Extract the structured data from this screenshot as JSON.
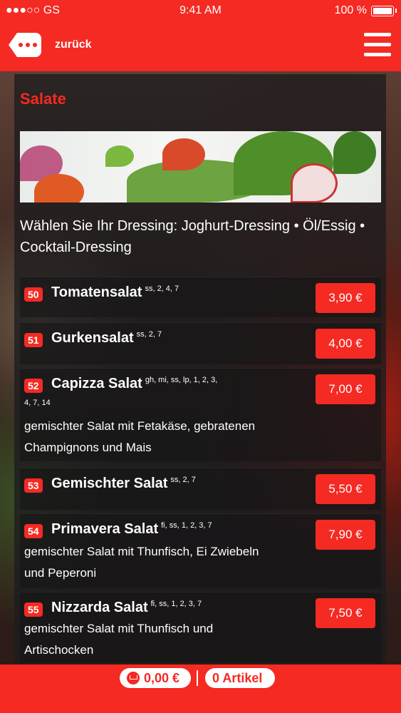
{
  "status_bar": {
    "carrier": "●●●○○ GS",
    "time": "9:41 AM",
    "battery": "100 %"
  },
  "nav": {
    "back_label": "zurück"
  },
  "section": {
    "title": "Salate",
    "intro": "Wählen Sie Ihr Dressing: Joghurt-Dressing • Öl/Essig • Cocktail-Dressing"
  },
  "items": [
    {
      "num": "50",
      "name": "Tomatensalat",
      "allergens": "ss, 2, 4, 7",
      "desc": "",
      "price": "3,90 €"
    },
    {
      "num": "51",
      "name": "Gurkensalat",
      "allergens": "ss, 2, 7",
      "desc": "",
      "price": "4,00 €"
    },
    {
      "num": "52",
      "name": "Capizza Salat",
      "allergens": "gh, mi, ss, lp, 1, 2, 3,",
      "allergens2": "4, 7, 14",
      "desc": "gemischter Salat mit Fetakäse, gebratenen Champignons und Mais",
      "price": "7,00 €"
    },
    {
      "num": "53",
      "name": "Gemischter Salat",
      "allergens": "ss, 2, 7",
      "desc": "",
      "price": "5,50 €"
    },
    {
      "num": "54",
      "name": "Primavera Salat",
      "allergens": "fi, ss, 1, 2, 3, 7",
      "desc": "gemischter Salat mit Thunfisch, Ei Zwiebeln und Peperoni",
      "price": "7,90 €"
    },
    {
      "num": "55",
      "name": "Nizzarda Salat",
      "allergens": "fi, ss, 1, 2, 3, 7",
      "desc": "gemischter Salat mit Thunfisch und Artischocken",
      "price": "7,50 €"
    }
  ],
  "cart": {
    "total": "0,00 €",
    "articles": "0 Artikel"
  },
  "colors": {
    "accent": "#f42a23"
  }
}
